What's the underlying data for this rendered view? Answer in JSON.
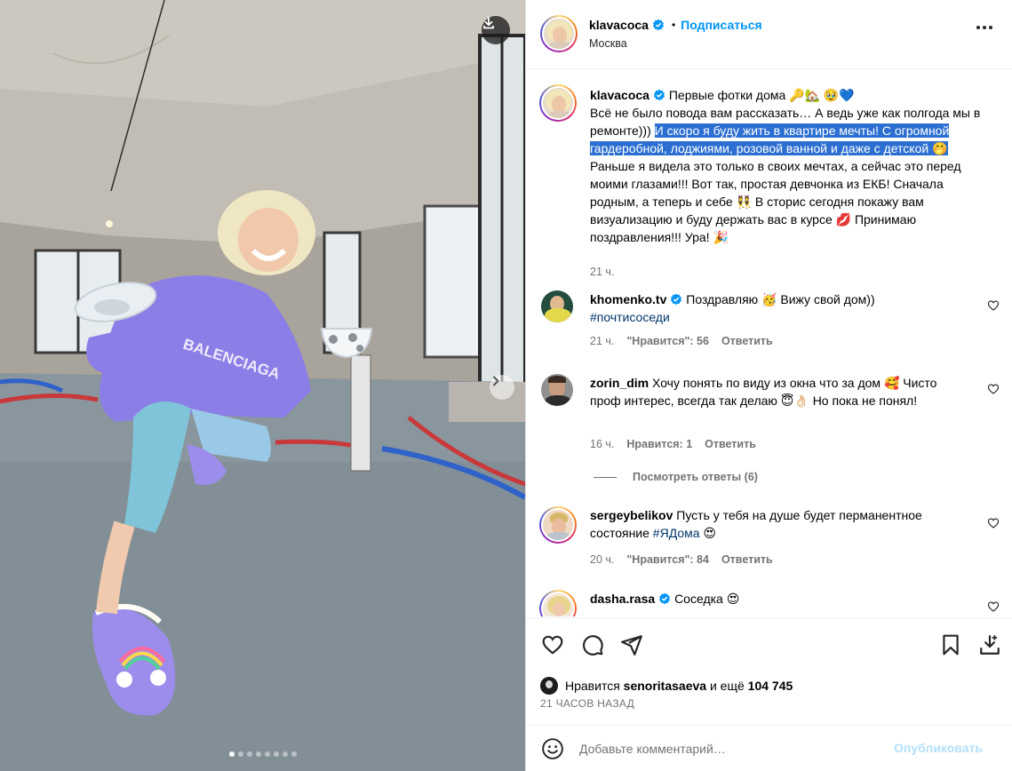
{
  "post": {
    "author": "klavacoca",
    "follow_label": "Подписаться",
    "separator": "•",
    "location": "Москва",
    "media_count": 8,
    "active_media_index": 0
  },
  "caption": {
    "username": "klavacoca",
    "part1": "Первые фотки дома 🔑🏡 🥹💙",
    "part2": "Всё не было повода вам рассказать… А ведь уже как полгода мы в ремонте)))",
    "highlighted": "И скоро я буду жить в квартире мечты! С огромной гардеробной, лоджиями, розовой ванной и даже с детской 🤭",
    "part3": "Раньше я видела это только в своих мечтах, а сейчас это перед моими глазами!!! Вот так, простая девчонка из ЕКБ! Сначала родным, а теперь и себе 👯 В сторис сегодня покажу вам визуализацию и буду держать вас в курсе 💋 Принимаю поздравления!!! Ура! 🎉",
    "time": "21 ч."
  },
  "comments": [
    {
      "username": "khomenko.tv",
      "verified": true,
      "text": "Поздравляю 🥳 Вижу свой дом))",
      "tag": "#почтисоседи",
      "time": "21 ч.",
      "likes": "\"Нравится\": 56",
      "reply": "Ответить"
    },
    {
      "username": "zorin_dim",
      "verified": false,
      "text": "Хочу понять по виду из окна что за дом 🥰 Чисто проф интерес, всегда так делаю 😇👌🏻 Но пока не понял!",
      "time": "16 ч.",
      "likes": "Нравится: 1",
      "reply": "Ответить"
    },
    {
      "username": "sergeybelikov",
      "verified": false,
      "text": "Пусть у тебя на душе будет перманентное состояние",
      "tag": "#ЯДома",
      "emoji": "😍",
      "time": "20 ч.",
      "likes": "\"Нравится\": 84",
      "reply": "Ответить"
    },
    {
      "username": "dasha.rasa",
      "verified": true,
      "text": "Соседка 😍"
    }
  ],
  "view_replies": "Посмотреть ответы (6)",
  "likes": {
    "prefix": "Нравится",
    "user": "senoritasaeva",
    "middle": "и ещё",
    "count": "104 745"
  },
  "post_time": "21 ЧАСОВ НАЗАД",
  "composer": {
    "placeholder": "Добавьте комментарий…",
    "value": "",
    "publish": "Опубликовать"
  },
  "colors": {
    "link": "#0095f6",
    "verified": "#0095f6",
    "muted": "#737373",
    "highlight": "#2c6fd1",
    "publish_disabled": "#b2dffc"
  },
  "icons": [
    "download-icon",
    "chevron-right-icon",
    "more-icon",
    "verified-icon",
    "heart-icon",
    "comment-icon",
    "share-icon",
    "save-icon",
    "emoji-icon"
  ]
}
